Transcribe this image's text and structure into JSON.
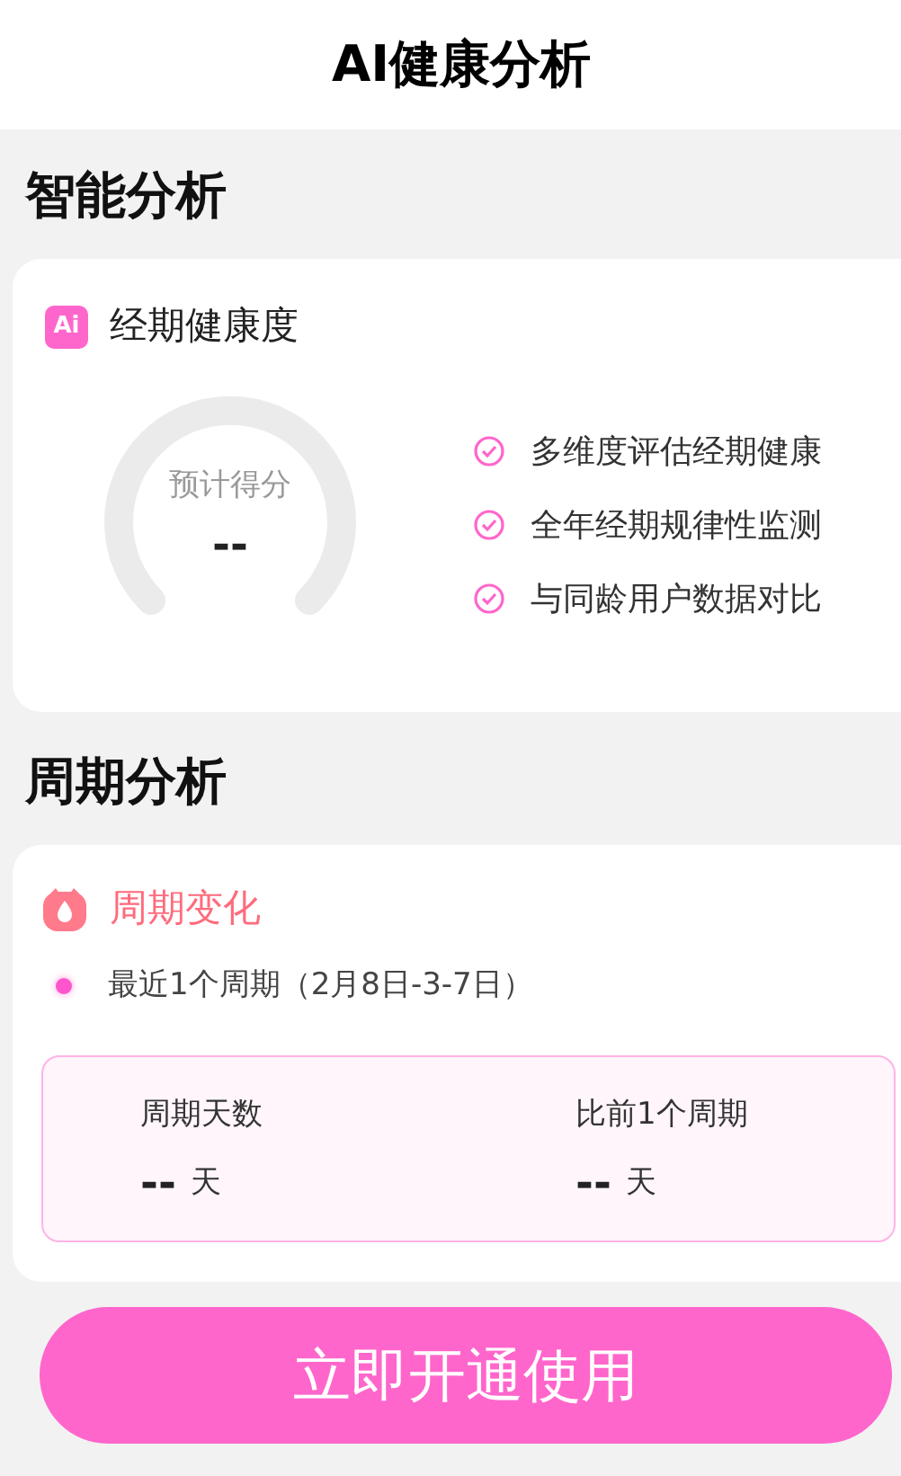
{
  "header": {
    "title": "AI健康分析"
  },
  "smart_analysis": {
    "heading": "智能分析",
    "card": {
      "badge": "Ai",
      "title": "经期健康度",
      "gauge": {
        "label": "预计得分",
        "value": "--"
      },
      "features": [
        "多维度评估经期健康",
        "全年经期规律性监测",
        "与同龄用户数据对比"
      ]
    }
  },
  "cycle_analysis": {
    "heading": "周期分析",
    "card": {
      "title": "周期变化",
      "recent": "最近1个周期（2月8日-3-7日）",
      "stats": [
        {
          "label": "周期天数",
          "value": "--",
          "unit": "天"
        },
        {
          "label": "比前1个周期",
          "value": "--",
          "unit": "天"
        }
      ]
    }
  },
  "action_button": "立即开通使用"
}
